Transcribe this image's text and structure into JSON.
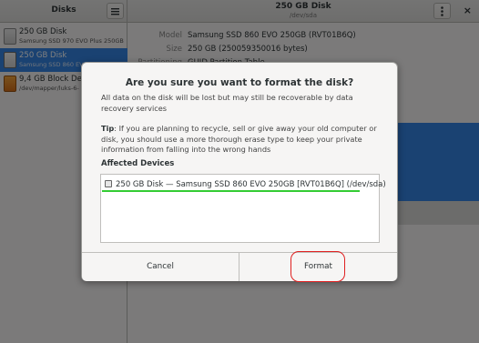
{
  "header": {
    "app_title": "Disks",
    "menu_icon": "hamburger-menu-icon",
    "disk_title": "250 GB Disk",
    "disk_subtitle": "/dev/sda",
    "more_icon": "vertical-dots-icon",
    "close_icon": "close-icon",
    "close_glyph": "×"
  },
  "sidebar": {
    "items": [
      {
        "name": "250 GB Disk",
        "sub": "Samsung SSD 970 EVO Plus 250GB",
        "selected": false,
        "icon": "hard-disk-icon"
      },
      {
        "name": "250 GB Disk",
        "sub": "Samsung SSD 860 EVO 250GB",
        "selected": true,
        "icon": "hard-disk-icon"
      },
      {
        "name": "9,4 GB Block Device",
        "sub": "/dev/mapper/luks-6-",
        "selected": false,
        "icon": "block-device-icon"
      }
    ]
  },
  "main": {
    "model_label": "Model",
    "model_value": "Samsung SSD 860 EVO 250GB (RVT01B6Q)",
    "size_label": "Size",
    "size_value": "250 GB (250059350016 bytes)",
    "partitioning_label": "Partitioning",
    "partitioning_value": "GUID Partition Table"
  },
  "dialog": {
    "title": "Are you sure you want to format the disk?",
    "body": "All data on the disk will be lost but may still be recoverable by data recovery services",
    "tip_label": "Tip",
    "tip_text": ": If you are planning to recycle, sell or give away your old computer or disk, you should use a more thorough erase type to keep your private information from falling into the wrong hands",
    "affected_label": "Affected Devices",
    "device_item": "250 GB Disk — Samsung SSD 860 EVO 250GB [RVT01B6Q] (/dev/sda)",
    "cancel_label": "Cancel",
    "format_label": "Format"
  },
  "colors": {
    "accent": "#3584e4",
    "highlight_underline": "#33cc33",
    "annotation_ring": "#e02020"
  }
}
